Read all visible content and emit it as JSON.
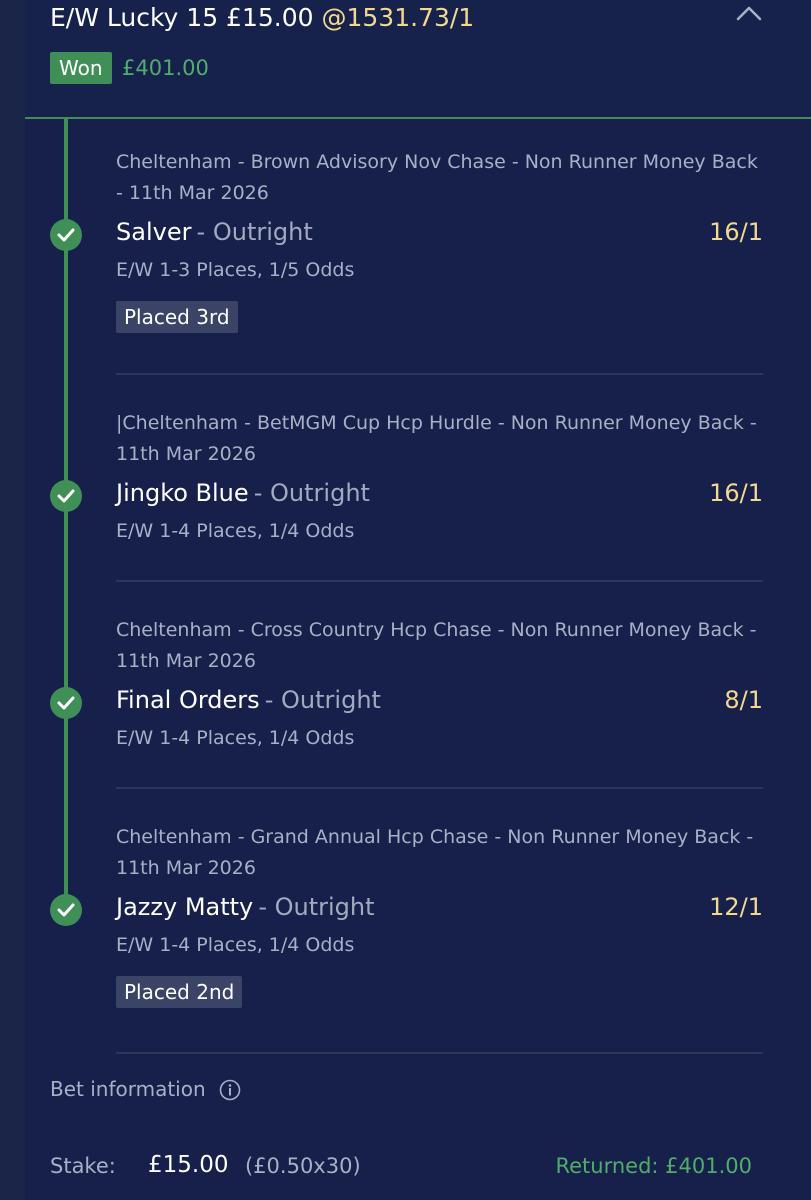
{
  "header": {
    "bet_title": "E/W Lucky 15 £15.00",
    "bet_odds": "@1531.73/1",
    "status_badge": "Won",
    "won_amount": "£401.00",
    "collapse_icon": "chevron-up-icon"
  },
  "selections": [
    {
      "event": "Cheltenham - Brown Advisory Nov Chase - Non Runner Money Back - 11th Mar 2026",
      "runner": "Salver",
      "market": "- Outright",
      "odds": "16/1",
      "terms": "E/W 1-3 Places, 1/5 Odds",
      "result": "Placed 3rd"
    },
    {
      "event": "|Cheltenham - BetMGM Cup Hcp Hurdle - Non Runner Money Back - 11th Mar 2026",
      "runner": "Jingko Blue",
      "market": "- Outright",
      "odds": "16/1",
      "terms": "E/W 1-4 Places, 1/4 Odds",
      "result": ""
    },
    {
      "event": "Cheltenham - Cross Country Hcp Chase - Non Runner Money Back - 11th Mar 2026",
      "runner": "Final Orders",
      "market": "- Outright",
      "odds": "8/1",
      "terms": "E/W 1-4 Places, 1/4 Odds",
      "result": ""
    },
    {
      "event": "Cheltenham - Grand Annual Hcp Chase - Non Runner Money Back - 11th Mar 2026",
      "runner": "Jazzy Matty",
      "market": "- Outright",
      "odds": "12/1",
      "terms": "E/W 1-4 Places, 1/4 Odds",
      "result": "Placed 2nd"
    }
  ],
  "bet_info": {
    "label": "Bet information",
    "icon": "info-icon",
    "stake_label": "Stake:",
    "stake_value": "£15.00",
    "stake_detail": "(£0.50x30)",
    "returned": "Returned: £401.00"
  },
  "colors": {
    "background": "#16204a",
    "accent_green": "#3f8f57",
    "won_text": "#4fae69",
    "odds_gold": "#f3d98f"
  }
}
